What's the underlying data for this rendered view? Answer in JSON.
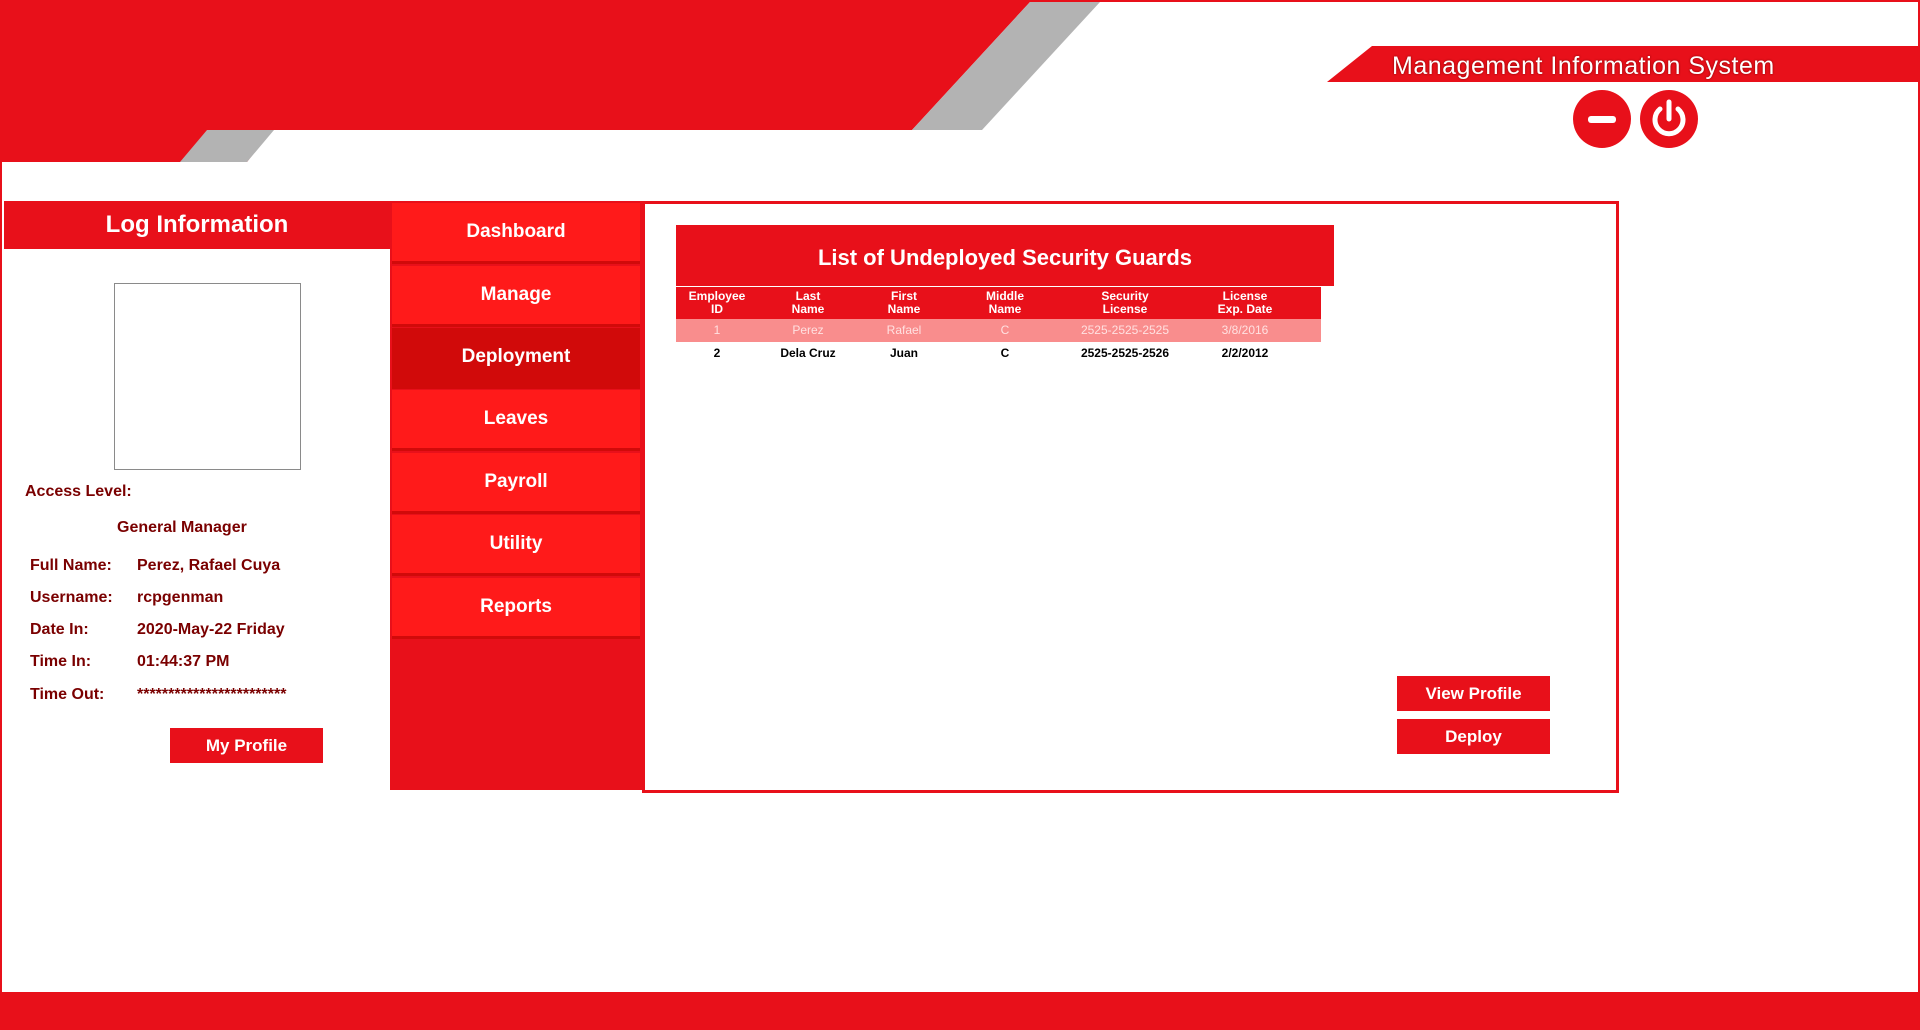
{
  "app": {
    "title": "Management Information System",
    "accent_color": "#e8101a",
    "minimize_icon": "minimize-icon",
    "power_icon": "power-icon"
  },
  "log": {
    "header": "Log Information",
    "access_level_label": "Access Level:",
    "access_level_value": "General Manager",
    "fields": [
      {
        "label": "Full Name:",
        "value": "Perez, Rafael Cuya"
      },
      {
        "label": "Username:",
        "value": "rcpgenman"
      },
      {
        "label": "Date In:",
        "value": "2020-May-22 Friday"
      },
      {
        "label": "Time In:",
        "value": "01:44:37 PM"
      },
      {
        "label": "Time Out:",
        "value": "************************"
      }
    ],
    "my_profile_label": "My Profile"
  },
  "nav": {
    "items": [
      "Dashboard",
      "Manage",
      "Deployment",
      "Leaves",
      "Payroll",
      "Utility",
      "Reports"
    ],
    "active": "Deployment"
  },
  "main": {
    "list_title": "List of Undeployed Security Guards",
    "columns": [
      [
        "Employee",
        "ID"
      ],
      [
        "Last",
        "Name"
      ],
      [
        "First",
        "Name"
      ],
      [
        "Middle",
        "Name"
      ],
      [
        "Security",
        "License"
      ],
      [
        "License",
        "Exp. Date"
      ]
    ],
    "rows": [
      [
        "1",
        "Perez",
        "Rafael",
        "C",
        "2525-2525-2525",
        "3/8/2016"
      ],
      [
        "2",
        "Dela Cruz",
        "Juan",
        "C",
        "2525-2525-2526",
        "2/2/2012"
      ]
    ],
    "selected_row": 0,
    "view_profile_label": "View Profile",
    "deploy_label": "Deploy"
  }
}
